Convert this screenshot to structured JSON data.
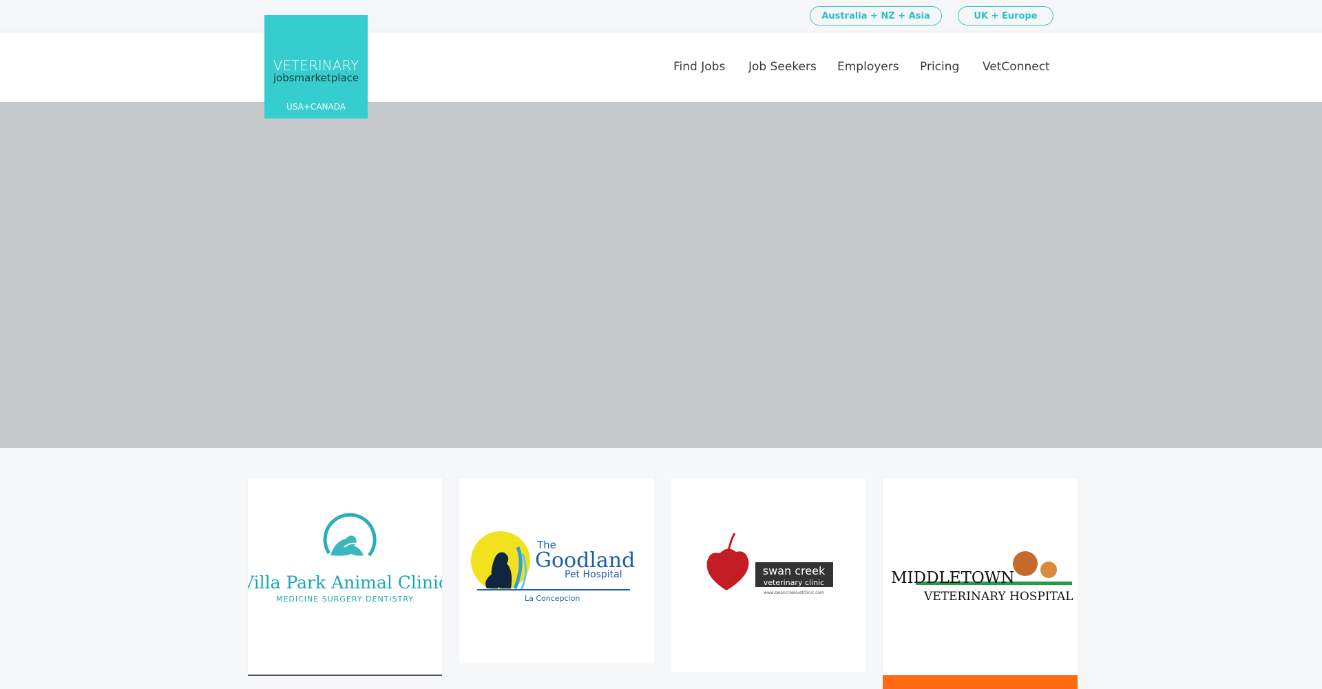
{
  "regions": {
    "australia": "Australia + NZ + Asia",
    "uk": "UK + Europe"
  },
  "logo": {
    "line1": "VETERINARY",
    "line2": "jobsmarketplace",
    "line3": "USA+CANADA"
  },
  "nav": {
    "find_jobs": "Find Jobs",
    "job_seekers": "Job Seekers",
    "employers": "Employers",
    "pricing": "Pricing",
    "vetconnect": "VetConnect"
  },
  "cards": [
    {
      "name": "Villa Park Animal Clinic",
      "line2": "MEDICINE   SURGERY   DENTISTRY"
    },
    {
      "name_top": "The",
      "name": "Goodland",
      "line2": "Pet Hospital",
      "line3": "La Concepcion"
    },
    {
      "name": "swan creek",
      "line2": "veterinary clinic",
      "line3": "www.swancreekvetclinic.com"
    },
    {
      "name": "MIDDLETOWN",
      "line2": "VETERINARY HOSPITAL"
    }
  ],
  "colors": {
    "accent": "#35cdcd",
    "hero": "#c5c9cc",
    "orange": "#ff6a13"
  }
}
